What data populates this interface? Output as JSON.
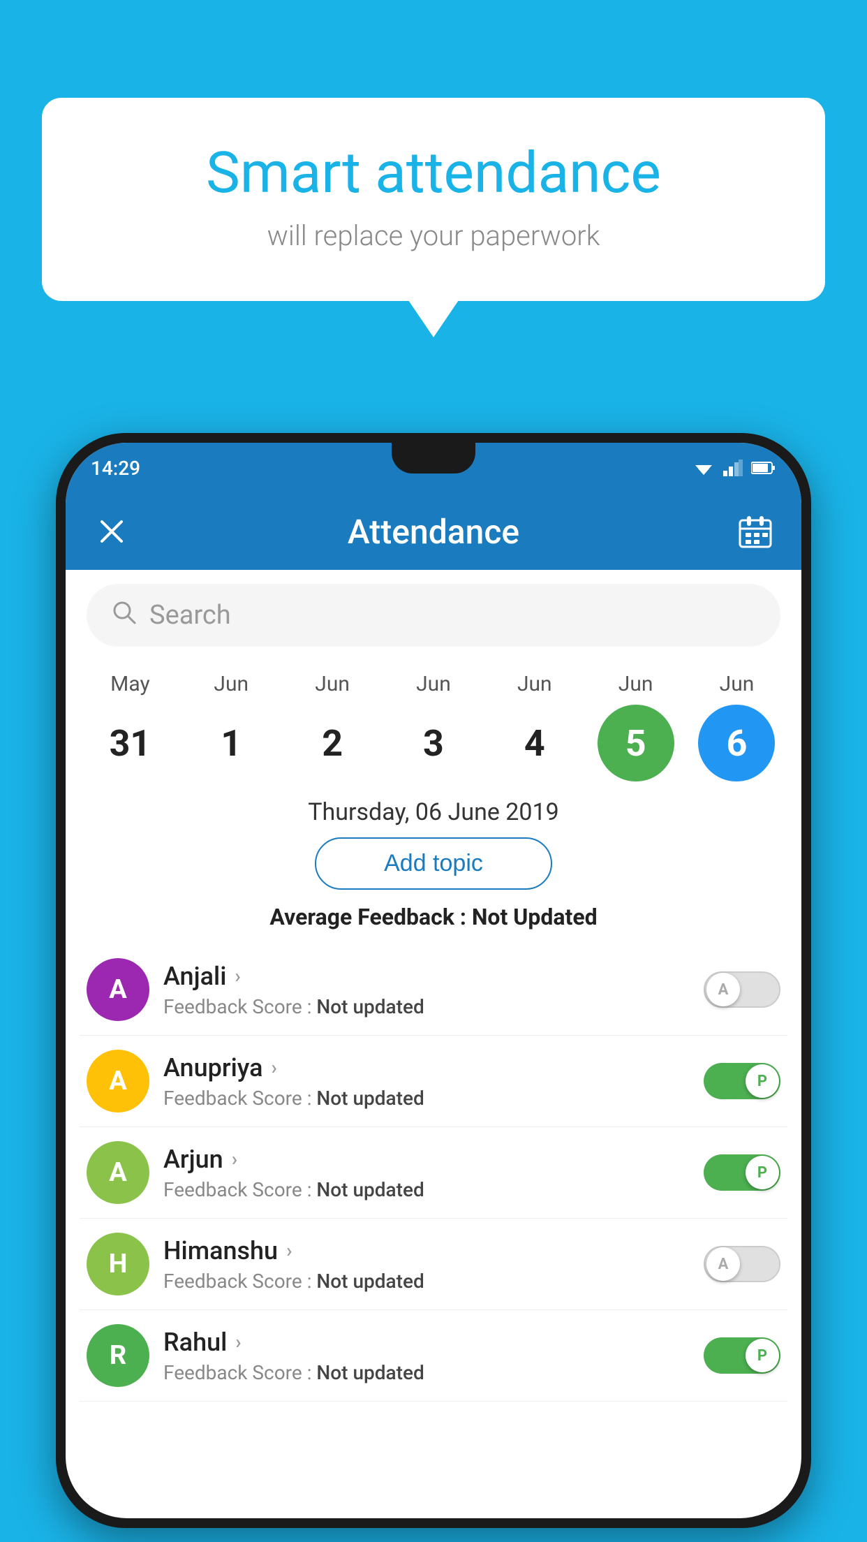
{
  "background_color": "#1ab3e8",
  "speech_bubble": {
    "title": "Smart attendance",
    "subtitle": "will replace your paperwork"
  },
  "status_bar": {
    "time": "14:29"
  },
  "app_bar": {
    "title": "Attendance",
    "close_label": "×",
    "calendar_icon": "calendar-icon"
  },
  "search": {
    "placeholder": "Search"
  },
  "calendar": {
    "items": [
      {
        "month": "May",
        "day": "31",
        "style": ""
      },
      {
        "month": "Jun",
        "day": "1",
        "style": ""
      },
      {
        "month": "Jun",
        "day": "2",
        "style": ""
      },
      {
        "month": "Jun",
        "day": "3",
        "style": ""
      },
      {
        "month": "Jun",
        "day": "4",
        "style": ""
      },
      {
        "month": "Jun",
        "day": "5",
        "style": "today"
      },
      {
        "month": "Jun",
        "day": "6",
        "style": "selected"
      }
    ]
  },
  "selected_date": "Thursday, 06 June 2019",
  "add_topic_label": "Add topic",
  "average_feedback": {
    "label": "Average Feedback : ",
    "value": "Not Updated"
  },
  "students": [
    {
      "name": "Anjali",
      "avatar_letter": "A",
      "avatar_color": "#9c27b0",
      "feedback": "Not updated",
      "toggle": "off",
      "toggle_label": "A"
    },
    {
      "name": "Anupriya",
      "avatar_letter": "A",
      "avatar_color": "#ffc107",
      "feedback": "Not updated",
      "toggle": "on",
      "toggle_label": "P"
    },
    {
      "name": "Arjun",
      "avatar_letter": "A",
      "avatar_color": "#8bc34a",
      "feedback": "Not updated",
      "toggle": "on",
      "toggle_label": "P"
    },
    {
      "name": "Himanshu",
      "avatar_letter": "H",
      "avatar_color": "#8bc34a",
      "feedback": "Not updated",
      "toggle": "off",
      "toggle_label": "A"
    },
    {
      "name": "Rahul",
      "avatar_letter": "R",
      "avatar_color": "#4caf50",
      "feedback": "Not updated",
      "toggle": "on",
      "toggle_label": "P"
    }
  ]
}
